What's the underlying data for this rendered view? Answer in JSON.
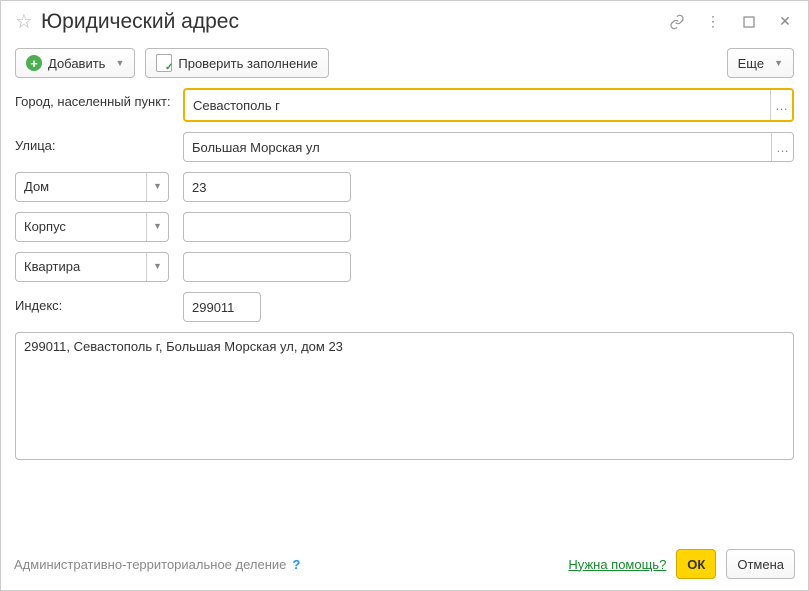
{
  "title": "Юридический адрес",
  "toolbar": {
    "add_label": "Добавить",
    "check_label": "Проверить заполнение",
    "more_label": "Еще"
  },
  "form": {
    "city_label": "Город, населенный пункт:",
    "city_value": "Севастополь г",
    "street_label": "Улица:",
    "street_value": "Большая Морская ул",
    "house_select": "Дом",
    "house_value": "23",
    "korpus_select": "Корпус",
    "korpus_value": "",
    "flat_select": "Квартира",
    "flat_value": "",
    "index_label": "Индекс:",
    "index_value": "299011",
    "full_address": "299011, Севастополь г, Большая Морская ул, дом 23"
  },
  "footer": {
    "admin_label": "Административно-территориальное деление",
    "help_label": "Нужна помощь?",
    "ok_label": "ОК",
    "cancel_label": "Отмена"
  }
}
